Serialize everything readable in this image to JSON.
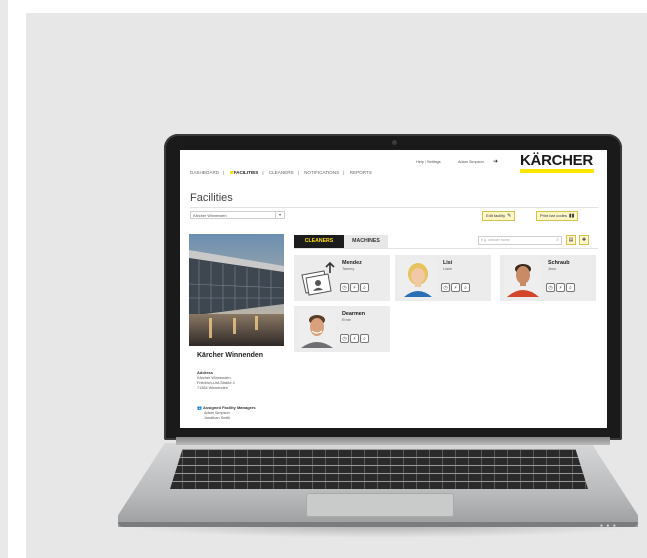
{
  "nav": {
    "items": [
      {
        "label": "DASHBOARD",
        "active": false
      },
      {
        "label": "FACILITIES",
        "active": true
      },
      {
        "label": "CLEANERS",
        "active": false
      },
      {
        "label": "NOTIFICATIONS",
        "active": false
      },
      {
        "label": "REPORTS",
        "active": false
      }
    ],
    "separator": "|"
  },
  "header": {
    "help_settings": "Help / Settings",
    "user_name": "Adam Simpson",
    "brand": "KÄRCHER"
  },
  "page": {
    "title": "Facilities",
    "facility_select_value": "Kärcher Winnenden",
    "edit_facility_label": "Edit facility",
    "print_bar_codes_label": "Print bar codes"
  },
  "tabs": {
    "cleaners": "CLEANERS",
    "machines": "MACHINES",
    "active": "cleaners"
  },
  "search": {
    "placeholder": "e.g. cleaner name"
  },
  "facility": {
    "name": "Kärcher Winnenden",
    "address_heading": "Address",
    "address_lines": [
      "Kärcher Winnenden",
      "Friedrich-List-Straße 4",
      "71364 Winnenden"
    ],
    "managers_heading": "Assigned Facility Managers",
    "managers": [
      "Adam Simpson",
      "Jonathan Smith"
    ]
  },
  "cleaners": [
    {
      "last_name": "Mendez",
      "first_name": "Tammy",
      "photo": "upload-photo-placeholder"
    },
    {
      "last_name": "Lisi",
      "first_name": "Liane",
      "photo": "portrait-blonde-woman"
    },
    {
      "last_name": "Schraub",
      "first_name": "Jens",
      "photo": "portrait-man-red-shirt"
    },
    {
      "last_name": "Dearmen",
      "first_name": "Ernie",
      "photo": "portrait-smiling-man"
    }
  ],
  "colors": {
    "accent_yellow": "#ffde00",
    "tab_dark": "#1c1c1c",
    "card_bg": "#ececec",
    "panel_bg": "#e6e7e6"
  }
}
